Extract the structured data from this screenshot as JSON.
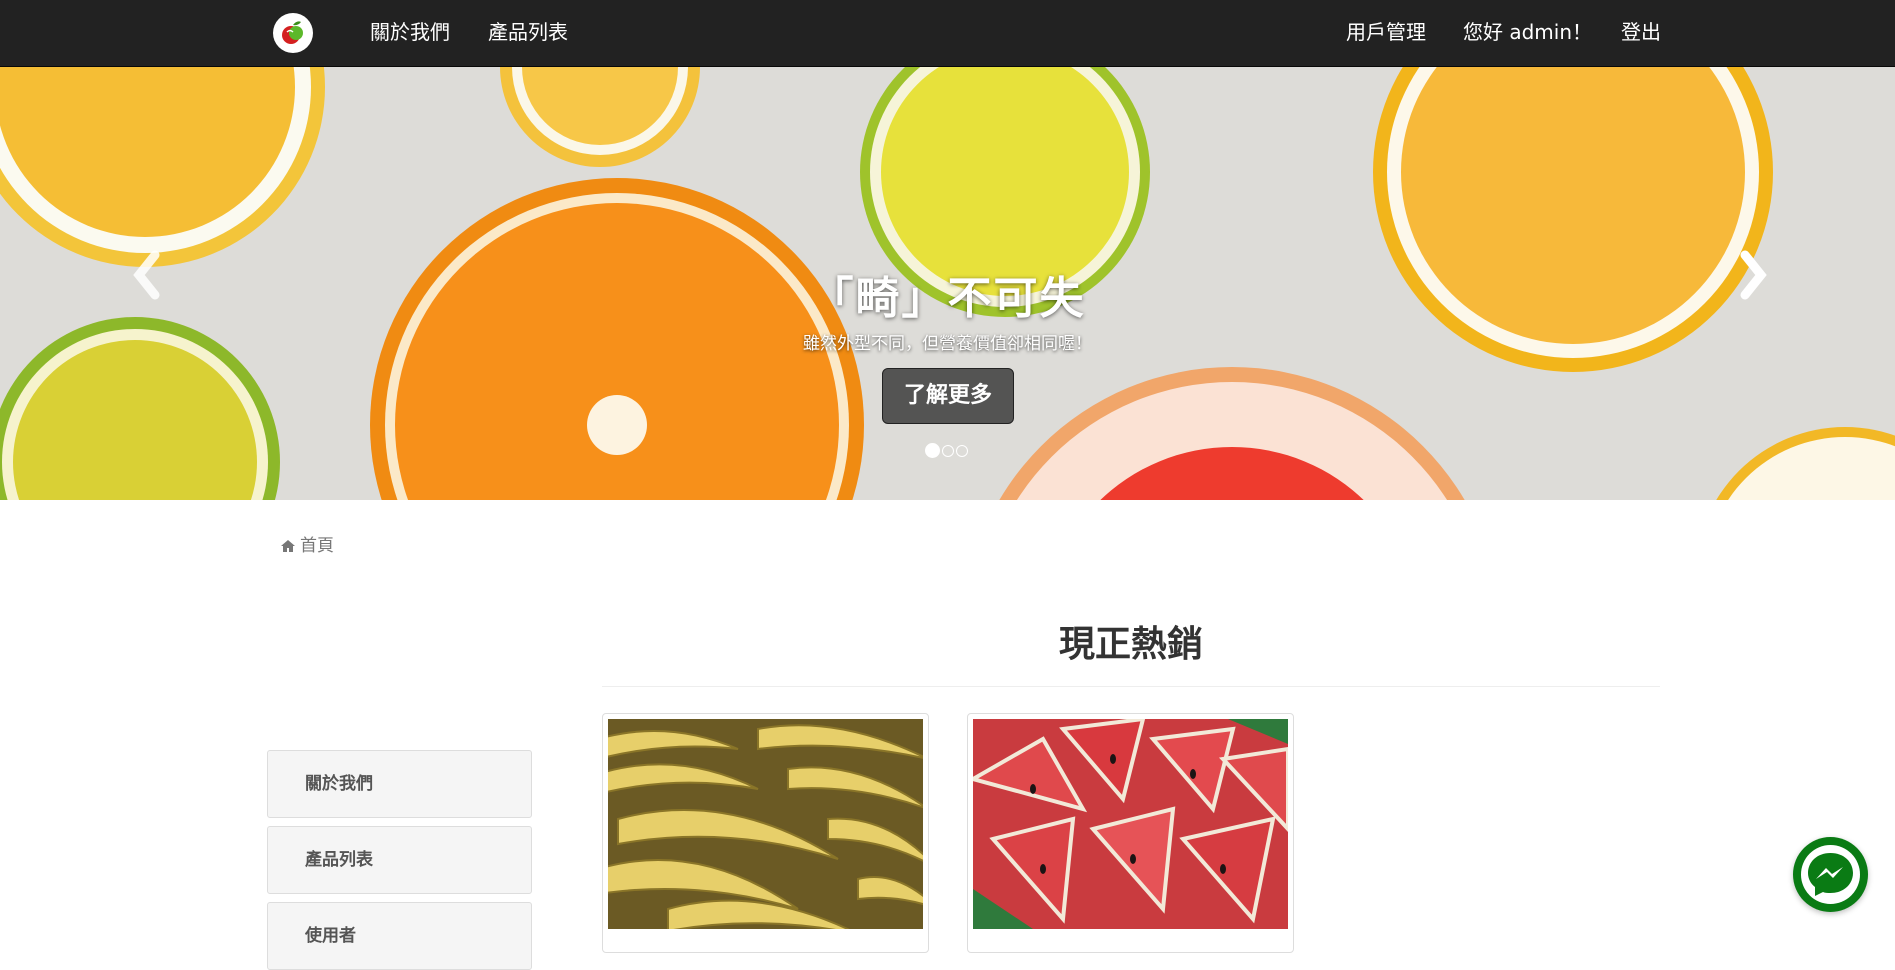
{
  "navbar": {
    "logo_icon": "apple-logo-icon",
    "left_links": [
      "關於我們",
      "產品列表"
    ],
    "right_links": [
      "用戶管理",
      "您好 admin！",
      "登出"
    ]
  },
  "hero": {
    "title": "「畸」不可失",
    "subtitle": "雖然外型不同，但營養價值卻相同喔！",
    "button_label": "了解更多",
    "slide_count": 3,
    "active_slide": 1,
    "prev_icon": "chevron-left-icon",
    "next_icon": "chevron-right-icon"
  },
  "breadcrumb": {
    "icon": "home-icon",
    "label": "首頁"
  },
  "section": {
    "title": "現正熱銷"
  },
  "sidebar": {
    "items": [
      "關於我們",
      "產品列表",
      "使用者"
    ]
  },
  "products": [
    {
      "image": "bananas"
    },
    {
      "image": "watermelon"
    }
  ],
  "messenger": {
    "icon": "messenger-icon",
    "color": "#0a7b14"
  }
}
